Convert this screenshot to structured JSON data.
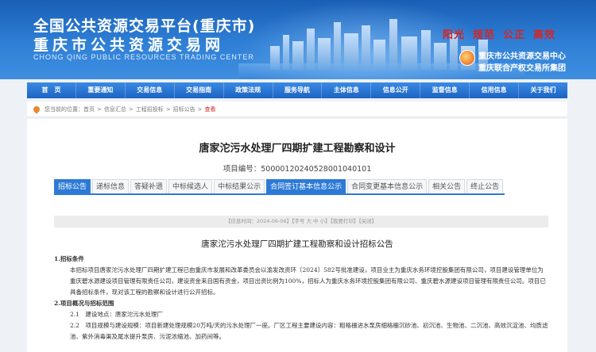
{
  "header": {
    "title_line1": "全国公共资源交易平台(重庆市)",
    "title_line2": "重庆市公共资源交易网",
    "title_en": "CHONG QING PUBLIC RESOURCES TRADING CENTER",
    "slogans": [
      "阳光",
      "规范",
      "公正",
      "高效"
    ],
    "org_line1": "重庆市公共资源交易中心",
    "org_line2": "重庆联合产权交易所集团",
    "brand_color": "#1c63c2",
    "slogan_color": "#d9231f"
  },
  "nav": {
    "items": [
      "首　页",
      "重要通知",
      "交易信息",
      "交易指南",
      "政策法规",
      "服务导航",
      "主体信息",
      "信息公开",
      "监督信息",
      "信用信息",
      "关于我们"
    ]
  },
  "breadcrumb": {
    "label": "您当前的位置：",
    "items": [
      "首页",
      "信息汇总",
      "工程招投标",
      "招标公告"
    ],
    "current": "查看"
  },
  "project": {
    "title": "唐家沱污水处理厂四期扩建工程勘察和设计",
    "code_label": "项目编号：",
    "code": "500001202405280010401​01"
  },
  "tabs": [
    {
      "label": "招标公告",
      "active": true
    },
    {
      "label": "递标信息",
      "active": false
    },
    {
      "label": "答疑补遗",
      "active": false
    },
    {
      "label": "中标候选人",
      "active": false
    },
    {
      "label": "中标结果公示",
      "active": false
    },
    {
      "label": "合同签订基本信息公示",
      "active": true
    },
    {
      "label": "合同变更基本信息公示",
      "active": false
    },
    {
      "label": "相关公告",
      "active": false
    },
    {
      "label": "终止公告",
      "active": false
    }
  ],
  "info_bar": "【信息时间：2024-06-06】【字号 大 中 小】【我要打印】【关闭】",
  "notice": {
    "title": "唐家沱污水处理厂四期扩建工程勘察和设计招标公告",
    "sec1": "1.招标条件",
    "p1": "本招标项目唐家沱污水处理厂四期扩建工程已由重庆市发展和改革委员会以渝发改资环〔2024〕582号批准建设，项目业主为重庆水务环境控股集团有限公司，项目建设管理单位为重庆碧水源建设项目管理有限责任公司，建设资金来自国有资金，项目出资比例为100%，招标人为重庆水务环境控股集团有限公司、重庆碧水源建设项目管理有限责任公司。项目已具备招标条件，现对该工程的勘察和设计进行公开招标。",
    "sec2": "2.项目概况与招标范围",
    "p2": "2.1　建设地点：唐家沱污水处理厂",
    "p3": "2.2　项目规模与建设规模：项目新建处理规模20万吨/天的污水处理厂一座。厂区工程主要建设内容：粗格栅进水泵房细格栅沉砂池、初沉池、生物池、二沉池、高效沉淀池、均质滤池、紫外消毒渠及尾水提升泵房、污泥浓缩池、加药间等。"
  }
}
